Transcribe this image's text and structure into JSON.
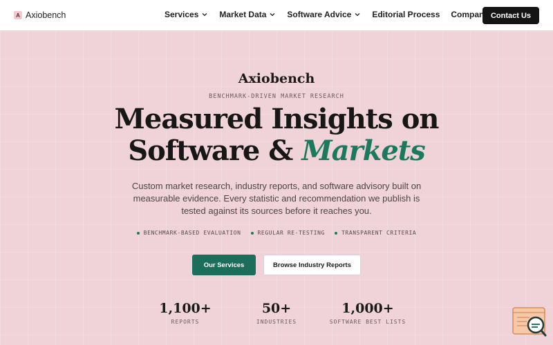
{
  "brand": {
    "mark": "A",
    "name": "Axiobench"
  },
  "nav": {
    "items": [
      {
        "label": "Services",
        "has_dropdown": true
      },
      {
        "label": "Market Data",
        "has_dropdown": true
      },
      {
        "label": "Software Advice",
        "has_dropdown": true
      },
      {
        "label": "Editorial Process",
        "has_dropdown": false
      },
      {
        "label": "Company",
        "has_dropdown": true
      }
    ],
    "cta": "Contact Us"
  },
  "hero": {
    "logo": "Axiobench",
    "eyebrow": "BENCHMARK-DRIVEN MARKET RESEARCH",
    "title_line1": "Measured Insights on",
    "title_line2_plain": "Software & ",
    "title_line2_accent": "Markets",
    "description": "Custom market research, industry reports, and software advisory built on measurable evidence. Every statistic and recommendation we publish is tested against its sources before it reaches you.",
    "checks": [
      "BENCHMARK-BASED EVALUATION",
      "REGULAR RE-TESTING",
      "TRANSPARENT CRITERIA"
    ],
    "primary_button": "Our Services",
    "secondary_button": "Browse Industry Reports"
  },
  "stats": [
    {
      "value": "1,100+",
      "label": "REPORTS"
    },
    {
      "value": "50+",
      "label": "INDUSTRIES"
    },
    {
      "value": "1,000+",
      "label": "SOFTWARE BEST LISTS"
    }
  ],
  "colors": {
    "background": "#efd3d8",
    "accent": "#1b7a5e",
    "primary_button": "#1b6f5a",
    "nav_cta": "#141414"
  },
  "icons": {
    "chevron": "chevron-down-icon",
    "chat": "chat-support-icon"
  }
}
